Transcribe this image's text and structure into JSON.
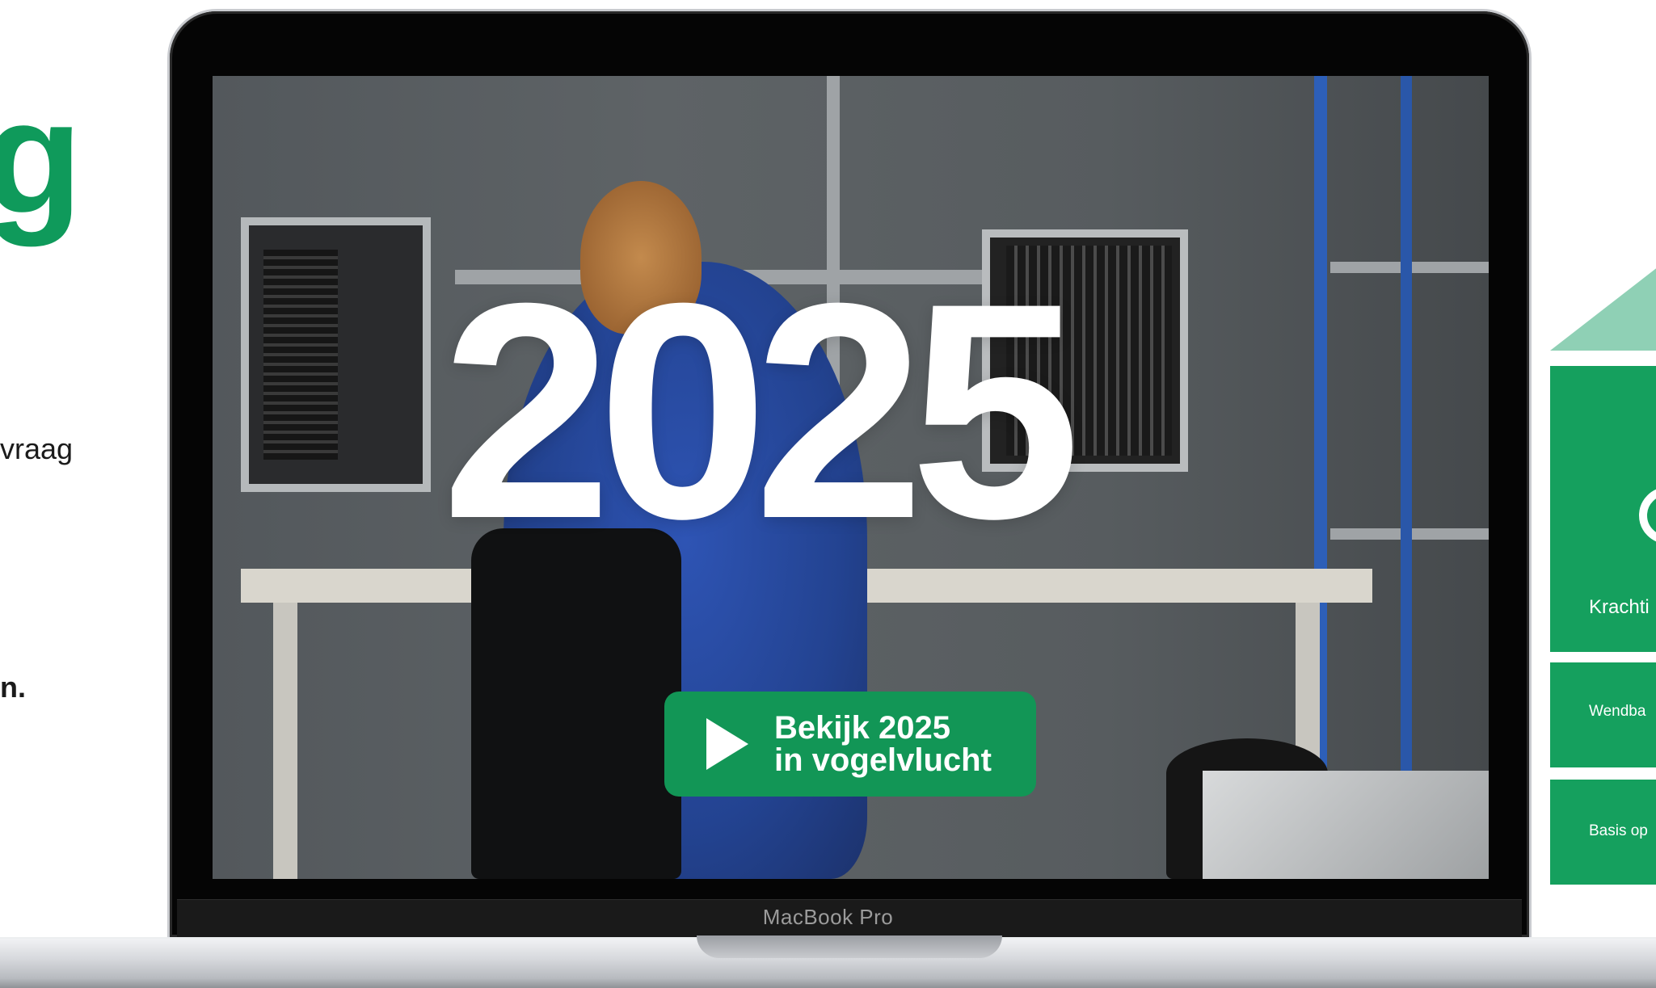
{
  "left": {
    "heading_fragment": "g",
    "line1_fragment": "vraag",
    "line2_fragment": "n."
  },
  "video": {
    "year_text": "2025",
    "cta_line1": "Bekijk 2025",
    "cta_line2": "in vogelvlucht"
  },
  "laptop": {
    "brand_label": "MacBook Pro"
  },
  "right_panel": {
    "cards": [
      {
        "label": "Krachti"
      },
      {
        "label": "Wendba"
      },
      {
        "label": "Basis op"
      }
    ]
  },
  "colors": {
    "brand_green": "#0f9a5b",
    "button_green": "#129656",
    "card_green": "#15a05e",
    "roof_green": "#8fd0b5"
  }
}
